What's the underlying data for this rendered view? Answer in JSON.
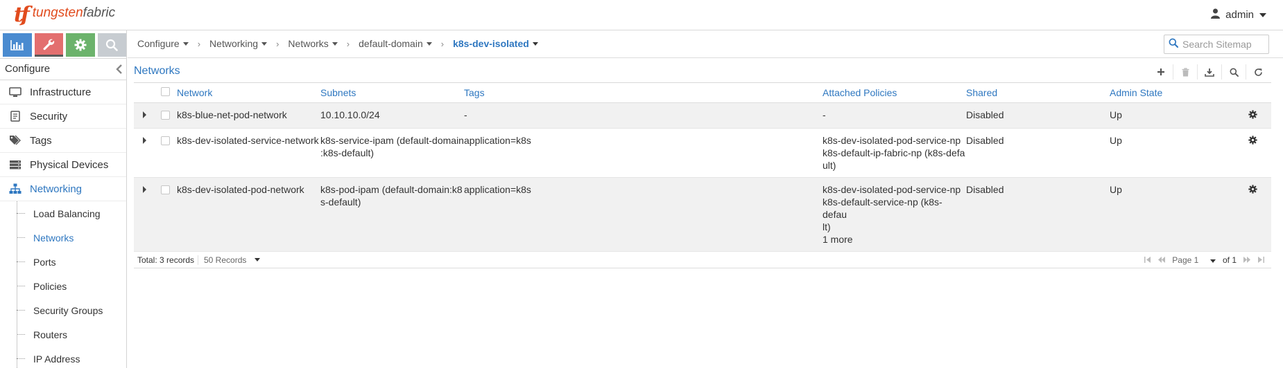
{
  "brand": {
    "mark": "tf",
    "name_part1": "tungsten",
    "name_part2": "fabric"
  },
  "user": {
    "name": "admin"
  },
  "sidebar": {
    "header": "Configure",
    "items": [
      {
        "label": "Infrastructure",
        "icon": "monitor-icon"
      },
      {
        "label": "Security",
        "icon": "security-icon"
      },
      {
        "label": "Tags",
        "icon": "tags-icon"
      },
      {
        "label": "Physical Devices",
        "icon": "physical-devices-icon"
      },
      {
        "label": "Networking",
        "icon": "networking-icon"
      }
    ],
    "sub_items": [
      "Load Balancing",
      "Networks",
      "Ports",
      "Policies",
      "Security Groups",
      "Routers",
      "IP Address"
    ]
  },
  "breadcrumb": [
    "Configure",
    "Networking",
    "Networks",
    "default-domain",
    "k8s-dev-isolated"
  ],
  "search": {
    "placeholder": "Search Sitemap"
  },
  "grid": {
    "title": "Networks",
    "columns": [
      "Network",
      "Subnets",
      "Tags",
      "Attached Policies",
      "Shared",
      "Admin State"
    ],
    "rows": [
      {
        "network": "k8s-blue-net-pod-network",
        "subnets": [
          "10.10.10.0/24"
        ],
        "tags": "-",
        "policies": [
          "-"
        ],
        "shared": "Disabled",
        "admin_state": "Up"
      },
      {
        "network": "k8s-dev-isolated-service-network",
        "subnets": [
          "k8s-service-ipam (default-domain",
          ":k8s-default)"
        ],
        "tags": "application=k8s",
        "policies": [
          "k8s-dev-isolated-pod-service-np",
          "k8s-default-ip-fabric-np (k8s-defa",
          "ult)"
        ],
        "shared": "Disabled",
        "admin_state": "Up"
      },
      {
        "network": "k8s-dev-isolated-pod-network",
        "subnets": [
          "k8s-pod-ipam (default-domain:k8",
          "s-default)"
        ],
        "tags": "application=k8s",
        "policies": [
          "k8s-dev-isolated-pod-service-np",
          "k8s-default-service-np (k8s-defau",
          "lt)",
          "1 more"
        ],
        "shared": "Disabled",
        "admin_state": "Up"
      }
    ],
    "footer": {
      "total": "Total: 3 records",
      "page_size": "50 Records",
      "page": "Page 1",
      "of": "of 1"
    }
  },
  "colors": {
    "accent": "#2e77c0",
    "brand_orange": "#e14b1d",
    "tab_monitor": "#4a8bd0",
    "tab_config": "#e36f6f",
    "tab_settings": "#6cb36c",
    "tab_query": "#c7ccd1",
    "row_alt": "#f1f1f1"
  }
}
